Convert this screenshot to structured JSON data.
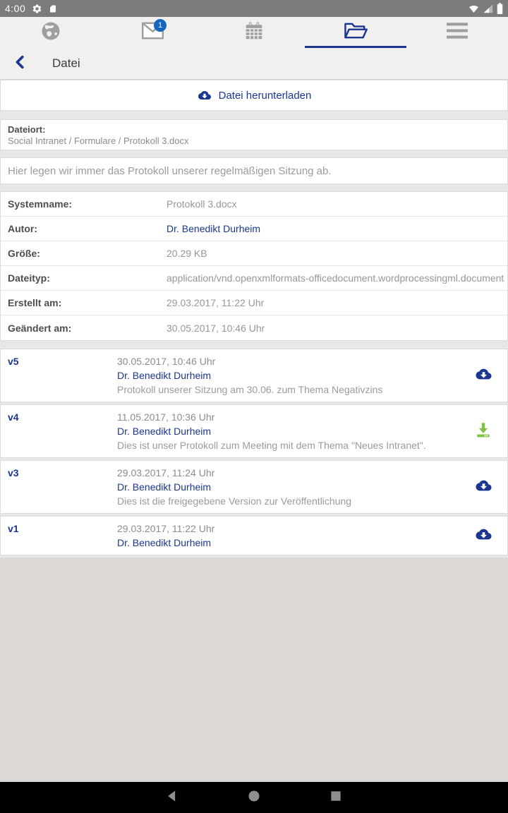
{
  "colors": {
    "accent_blue": "#1a3691",
    "badge_blue": "#1565c0",
    "green_download": "#7fc241"
  },
  "status_bar": {
    "time": "4:00"
  },
  "tab_bar": {
    "mail_badge": "1",
    "tabs": [
      "globe",
      "mail",
      "calendar",
      "files",
      "menu"
    ],
    "active_tab": "files"
  },
  "header": {
    "title": "Datei"
  },
  "download_action": {
    "label": "Datei herunterladen"
  },
  "location": {
    "label": "Dateiort:",
    "path": "Social Intranet / Formulare / Protokoll 3.docx"
  },
  "description": "Hier legen wir immer das Protokoll unserer regelmäßigen Sitzung ab.",
  "details": [
    {
      "label": "Systemname:",
      "value": "Protokoll 3.docx",
      "link": false
    },
    {
      "label": "Autor:",
      "value": "Dr. Benedikt Durheim",
      "link": true
    },
    {
      "label": "Größe:",
      "value": "20.29 KB",
      "link": false
    },
    {
      "label": "Dateityp:",
      "value": "application/vnd.openxmlformats-officedocument.wordprocessingml.document",
      "link": false
    },
    {
      "label": "Erstellt am:",
      "value": "29.03.2017, 11:22 Uhr",
      "link": false
    },
    {
      "label": "Geändert am:",
      "value": "30.05.2017, 10:46 Uhr",
      "link": false
    }
  ],
  "versions": [
    {
      "id": "v5",
      "date": "30.05.2017, 10:46 Uhr",
      "author": "Dr. Benedikt Durheim",
      "comment": "Protokoll unserer Sitzung am 30.06. zum Thema Negativzins",
      "icon": "cloud-download-blue"
    },
    {
      "id": "v4",
      "date": "11.05.2017, 10:36 Uhr",
      "author": "Dr. Benedikt Durheim",
      "comment": "Dies ist unser Protokoll zum Meeting mit dem Thema \"Neues Intranet\".",
      "icon": "download-done-green"
    },
    {
      "id": "v3",
      "date": "29.03.2017, 11:24 Uhr",
      "author": "Dr. Benedikt Durheim",
      "comment": "Dies ist die freigegebene Version zur Veröffentlichung",
      "icon": "cloud-download-blue"
    },
    {
      "id": "v1",
      "date": "29.03.2017, 11:22 Uhr",
      "author": "Dr. Benedikt Durheim",
      "comment": "",
      "icon": "cloud-download-blue"
    }
  ]
}
